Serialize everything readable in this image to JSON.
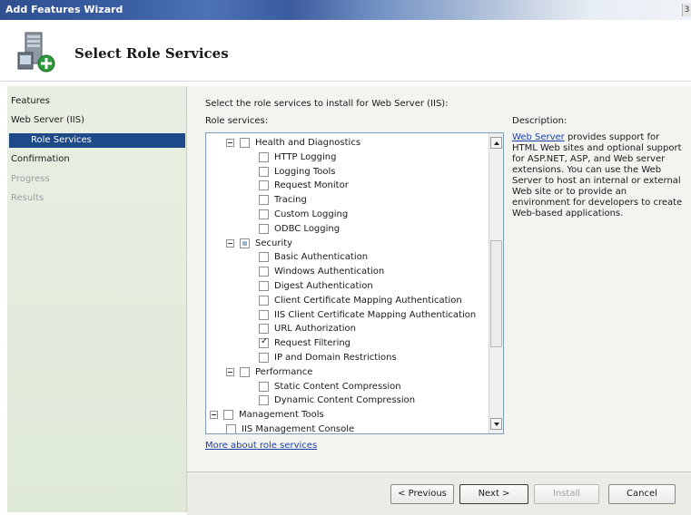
{
  "window": {
    "title": "Add Features Wizard"
  },
  "header": {
    "title": "Select Role Services",
    "icon": "server-role-icon"
  },
  "nav": {
    "items": [
      {
        "label": "Features",
        "state": "normal"
      },
      {
        "label": "Web Server (IIS)",
        "state": "normal"
      },
      {
        "label": "Role Services",
        "state": "active"
      },
      {
        "label": "Confirmation",
        "state": "normal"
      },
      {
        "label": "Progress",
        "state": "disabled"
      },
      {
        "label": "Results",
        "state": "disabled"
      }
    ]
  },
  "main": {
    "instruction": "Select the role services to install for Web Server (IIS):",
    "role_services_label": "Role services:",
    "description_label": "Description:",
    "more_link": "More about role services"
  },
  "tree": [
    {
      "label": "Health and Diagnostics",
      "level": 1,
      "state": "unchecked",
      "expander": true
    },
    {
      "label": "HTTP Logging",
      "level": 2,
      "state": "unchecked"
    },
    {
      "label": "Logging Tools",
      "level": 2,
      "state": "unchecked"
    },
    {
      "label": "Request Monitor",
      "level": 2,
      "state": "unchecked"
    },
    {
      "label": "Tracing",
      "level": 2,
      "state": "unchecked"
    },
    {
      "label": "Custom Logging",
      "level": 2,
      "state": "unchecked"
    },
    {
      "label": "ODBC Logging",
      "level": 2,
      "state": "unchecked"
    },
    {
      "label": "Security",
      "level": 1,
      "state": "partial",
      "expander": true
    },
    {
      "label": "Basic Authentication",
      "level": 2,
      "state": "unchecked"
    },
    {
      "label": "Windows Authentication",
      "level": 2,
      "state": "unchecked"
    },
    {
      "label": "Digest Authentication",
      "level": 2,
      "state": "unchecked"
    },
    {
      "label": "Client Certificate Mapping Authentication",
      "level": 2,
      "state": "unchecked"
    },
    {
      "label": "IIS Client Certificate Mapping Authentication",
      "level": 2,
      "state": "unchecked"
    },
    {
      "label": "URL Authorization",
      "level": 2,
      "state": "unchecked"
    },
    {
      "label": "Request Filtering",
      "level": 2,
      "state": "checked"
    },
    {
      "label": "IP and Domain Restrictions",
      "level": 2,
      "state": "unchecked"
    },
    {
      "label": "Performance",
      "level": 1,
      "state": "unchecked",
      "expander": true
    },
    {
      "label": "Static Content Compression",
      "level": 2,
      "state": "unchecked"
    },
    {
      "label": "Dynamic Content Compression",
      "level": 2,
      "state": "unchecked"
    },
    {
      "label": "Management Tools",
      "level": 0,
      "state": "unchecked",
      "expander": true
    },
    {
      "label": "IIS Management Console",
      "level": 1,
      "state": "unchecked"
    }
  ],
  "description": {
    "link": "Web Server",
    "text": " provides support for HTML Web sites and optional support for ASP.NET, ASP, and Web server extensions. You can use the Web Server to host an internal or external Web site or to provide an environment for developers to create Web-based applications."
  },
  "buttons": {
    "previous": "< Previous",
    "next": "Next >",
    "install": "Install",
    "cancel": "Cancel"
  }
}
